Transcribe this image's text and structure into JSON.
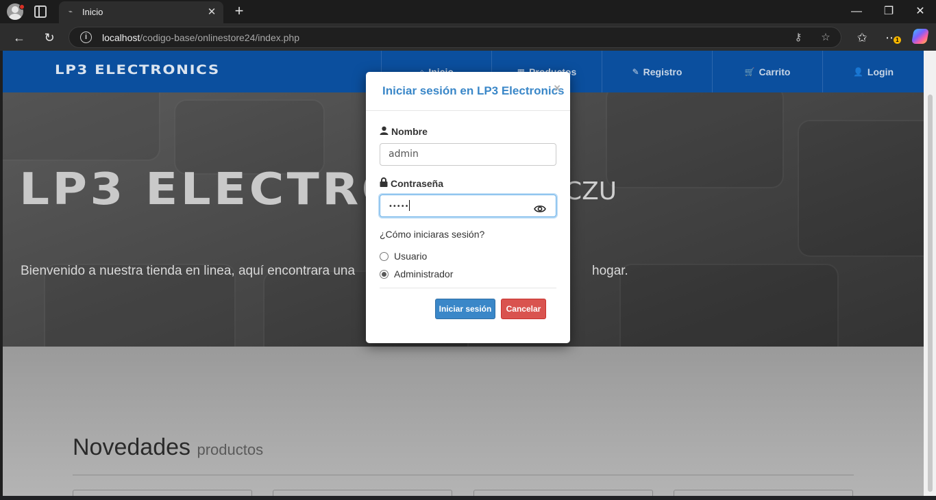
{
  "browser": {
    "tab_title": "Inicio",
    "tab_favicon": "favicon-icon",
    "new_tab": "+",
    "url_host": "localhost",
    "url_path": "/codigo-base/onlinestore24/index.php",
    "notification_badge": "1"
  },
  "nav": {
    "brand": "LP3 ELECTRONICS",
    "items": [
      {
        "label": "Inicio",
        "icon": "home-icon"
      },
      {
        "label": "Productos",
        "icon": "cubes-icon"
      },
      {
        "label": "Registro",
        "icon": "edit-icon"
      },
      {
        "label": "Carrito",
        "icon": "cart-icon"
      },
      {
        "label": "Login",
        "icon": "user-icon"
      }
    ]
  },
  "hero": {
    "title": "LP3 ELECTRO",
    "title_suffix": "CZU",
    "subtitle": "Bienvenido a nuestra tienda en linea, aquí encontrara una",
    "subtitle_end": "hogar."
  },
  "section": {
    "title": "Novedades",
    "title_small": "productos"
  },
  "modal": {
    "title": "Iniciar sesión en LP3 Electronics",
    "close": "×",
    "name_label": "Nombre",
    "name_value": "admin",
    "password_label": "Contraseña",
    "password_value": "•••••",
    "question": "¿Cómo iniciaras sesión?",
    "options": [
      "Usuario",
      "Administrador"
    ],
    "selected_option": "Administrador",
    "submit_label": "Iniciar sesión",
    "cancel_label": "Cancelar"
  },
  "colors": {
    "navbar": "#0b4f9e",
    "primary_button": "#3a87c8",
    "danger_button": "#d9534f",
    "modal_title": "#3a87c8"
  }
}
